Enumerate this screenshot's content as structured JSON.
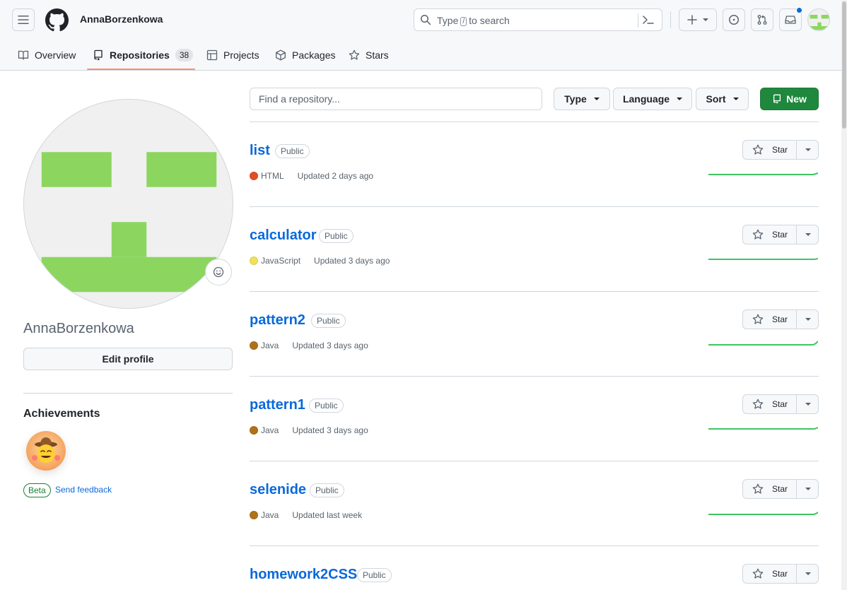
{
  "header": {
    "owner": "AnnaBorzenkowa",
    "search": {
      "placeholder_before": "Type",
      "kbd": "/",
      "placeholder_after": "to search"
    }
  },
  "tabs": [
    {
      "label": "Overview"
    },
    {
      "label": "Repositories",
      "count": "38",
      "selected": true
    },
    {
      "label": "Projects"
    },
    {
      "label": "Packages"
    },
    {
      "label": "Stars"
    }
  ],
  "profile": {
    "username": "AnnaBorzenkowa",
    "edit_label": "Edit profile",
    "achievements_title": "Achievements",
    "beta_label": "Beta",
    "feedback_label": "Send feedback"
  },
  "filters": {
    "find_placeholder": "Find a repository...",
    "type_label": "Type",
    "language_label": "Language",
    "sort_label": "Sort",
    "new_label": "New"
  },
  "repos": [
    {
      "name": "list",
      "visibility": "Public",
      "language": "HTML",
      "lang_color": "#e34c26",
      "updated": "Updated 2 days ago",
      "star_label": "Star"
    },
    {
      "name": "calculator",
      "visibility": "Public",
      "language": "JavaScript",
      "lang_color": "#f1e05a",
      "updated": "Updated 3 days ago",
      "star_label": "Star"
    },
    {
      "name": "pattern2",
      "visibility": "Public",
      "language": "Java",
      "lang_color": "#b07219",
      "updated": "Updated 3 days ago",
      "star_label": "Star"
    },
    {
      "name": "pattern1",
      "visibility": "Public",
      "language": "Java",
      "lang_color": "#b07219",
      "updated": "Updated 3 days ago",
      "star_label": "Star"
    },
    {
      "name": "selenide",
      "visibility": "Public",
      "language": "Java",
      "lang_color": "#b07219",
      "updated": "Updated last week",
      "star_label": "Star"
    },
    {
      "name": "homework2CSS",
      "visibility": "Public",
      "language": "",
      "lang_color": "",
      "updated": "",
      "star_label": "Star"
    }
  ],
  "colors": {
    "accent_link": "#0969da",
    "primary_button": "#1f883d",
    "tab_underline": "#fd8c73",
    "avatar_green": "#8cd65f"
  },
  "icons": [
    "menu-icon",
    "github-logo-icon",
    "search-icon",
    "command-palette-icon",
    "plus-icon",
    "issues-icon",
    "pull-requests-icon",
    "inbox-icon",
    "book-icon",
    "repo-icon",
    "table-icon",
    "package-icon",
    "star-icon",
    "smiley-icon",
    "caret-down-icon"
  ]
}
